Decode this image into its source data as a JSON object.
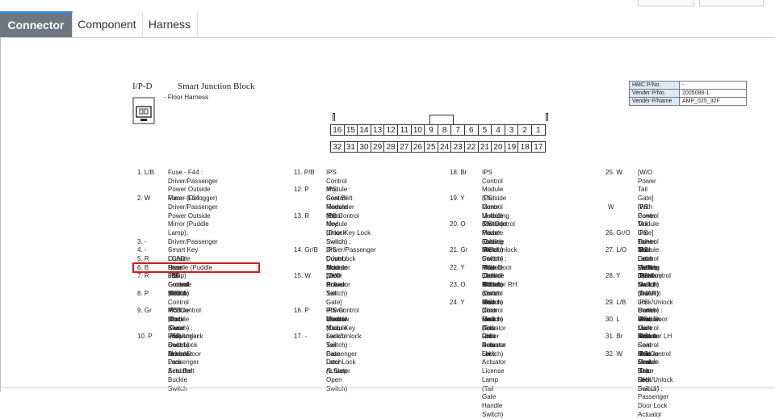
{
  "tabs": [
    {
      "label": "Connector"
    },
    {
      "label": "Component"
    },
    {
      "label": "Harness"
    }
  ],
  "connector": {
    "code": "I/P-D",
    "name": "Smart Junction Block",
    "harness": "- Floor Harness"
  },
  "info_table": [
    {
      "label": "HMC P/No.",
      "value": "-"
    },
    {
      "label": "Vender P/No.",
      "value": "2005088-1"
    },
    {
      "label": "Vender P/Name",
      "value": "AMP_025_32F"
    }
  ],
  "diagram": {
    "top_row": [
      "16",
      "15",
      "14",
      "13",
      "12",
      "11",
      "10",
      "9",
      "8",
      "7",
      "6",
      "5",
      "4",
      "3",
      "2",
      "1"
    ],
    "bottom_row": [
      "32",
      "31",
      "30",
      "29",
      "28",
      "27",
      "26",
      "25",
      "24",
      "23",
      "22",
      "21",
      "20",
      "19",
      "18",
      "17"
    ]
  },
  "pins": {
    "col1": [
      {
        "id": "1. L/B",
        "desc": "Fuse - F44 :\nDriver/Passenger Power Outside\nMirror (Defogger)"
      },
      {
        "id": "2. W",
        "desc": "Fuse - F14 :\nDriver/Passenger Power Outside\nMirror (Puddle Lamp),\nDriver/Passenger Smart Key Outside\nHandle (Puddle Lamp)"
      },
      {
        "id": "3. -",
        "desc": "-"
      },
      {
        "id": "4. -",
        "desc": "-"
      },
      {
        "id": "5. R",
        "desc": "LCAD Fuse - F36 : Console Switch"
      },
      {
        "id": "6. B",
        "desc": "Stop LED Ground (GR01)"
      },
      {
        "id": "7. R",
        "desc": "IPS Control Module :\nPCB Block (Fuse - F54)"
      },
      {
        "id": "8. P",
        "desc": "IPS Control Module (Door Switch) :\nPassenger Door Lock Actuator"
      },
      {
        "id": "9. Gr",
        "desc": "IPS Control Module\n(Door Lock/Unlock Switch) :\nDriver Door Lock Actuator"
      },
      {
        "id": "10. P",
        "desc": "IPS Control Module :\nPassenger Seat Belt Buckle Switch"
      }
    ],
    "col2": [
      {
        "id": "11. P/B",
        "desc": "IPS Control Module :\nSeat Belt Reminder Mat"
      },
      {
        "id": "12. P",
        "desc": "IPS Control Module\n(Door Key Unlock Switch) :\nDriver Door Lock Actuator"
      },
      {
        "id": "13. R",
        "desc": "IPS Control Module\n(Door Key Lock Switch) :\nDriver/Passenger Door Lock\nActuator"
      },
      {
        "id": "14. Gr/B",
        "desc": "IPS Control Module\n(Door Unlock Switch) :\nPower Window Main Switch"
      },
      {
        "id": "15. W",
        "desc": "[W/O Power Tail Gate]\nIPS Control Module :\nTail Gate Latch\n(1 Step Open Switch)"
      },
      {
        "id": "16. P",
        "desc": "IPS Control Module\n(Door Key Lock/Unlock Switch) :\nPassenger Door Lock Actuator"
      },
      {
        "id": "17. -",
        "desc": "-"
      }
    ],
    "col3": [
      {
        "id": "18. Br",
        "desc": "IPS Control Module\n(Outside Mirror Unfolding Switch) :\nPower Outside Mirror Switch"
      },
      {
        "id": "19. Y",
        "desc": "IPS Control Module\n(Outside Mirror Folding Switch) :\nPower Outside Mirror Switch"
      },
      {
        "id": "20. O",
        "desc": "IPS Control Module\n(Door Lock/Unlock Switch) :\nRear Door Lock Actuator RH"
      },
      {
        "id": "21. Gr",
        "desc": "IPS Control Module (Door Switch) :\nRear Door Lock Actuator RH"
      },
      {
        "id": "22. Y",
        "desc": "IPS Control Module (Door Switch) :\nRear Door Lock Actuator LH"
      },
      {
        "id": "23. O",
        "desc": "IPS Control Module (Door Switch) :\nDriver Door Lock Actuator"
      },
      {
        "id": "24. Y",
        "desc": "IPS Control Module\n(Tail Gate Release Switch) :\nLicense Lamp\n(Tail Gate Handle Switch)"
      }
    ],
    "col4": [
      {
        "id": "25. W",
        "desc": "[W/O Power Tail Gate]\nIPS Control Module :\nTail Gate Latch\n(2 Step Open Switch)"
      },
      {
        "id": "W",
        "desc": "[With Power Tail Gate]\nPower Tail Gate Latch\n(Primary Switch (AJAR))"
      },
      {
        "id": "26. Gr/O",
        "desc": "IPS Control Module :\nParking Brake Switch"
      },
      {
        "id": "27. L/O",
        "desc": "IPS Control Module\n(Door Lock Switch) :\nPower Window Main Switch"
      },
      {
        "id": "28. Y",
        "desc": "IPS Control Module\n(Door Lock/Unlock Switch) :\nRear Door Lock Actuator LH"
      },
      {
        "id": "29. L/B",
        "desc": "IPS Control Module :\nRear Seat Belt Center"
      },
      {
        "id": "30. L",
        "desc": "IPS Control Module :\nRear Seat Belt RH"
      },
      {
        "id": "31. Br",
        "desc": "IPS Control Module :\nRear Seat Belt LH"
      },
      {
        "id": "32. W",
        "desc": "IPS Control Module\n(Door Lock/Unlock Switch) :\nPassenger Door Lock Actuator"
      }
    ]
  },
  "colors": {
    "active_tab": "#6e7781",
    "highlight": "#d11b1b",
    "tab_accent": "#3a84c9"
  }
}
